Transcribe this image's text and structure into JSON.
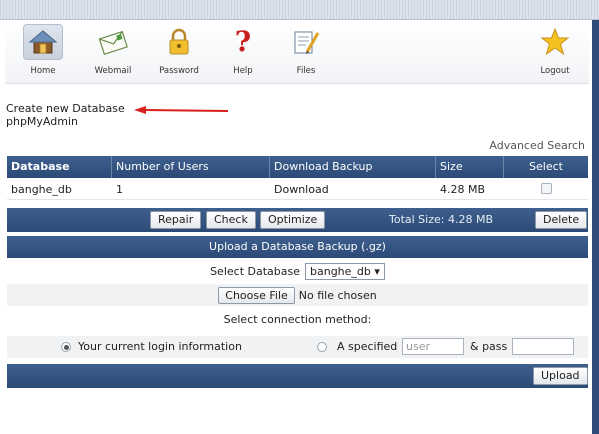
{
  "toolbar": {
    "items": [
      {
        "label": "Home",
        "icon": "home-icon"
      },
      {
        "label": "Webmail",
        "icon": "envelope-icon"
      },
      {
        "label": "Password",
        "icon": "padlock-icon"
      },
      {
        "label": "Help",
        "icon": "question-mark-icon"
      },
      {
        "label": "Files",
        "icon": "files-icon"
      },
      {
        "label": "Logout",
        "icon": "star-icon"
      }
    ]
  },
  "links": {
    "create_db": "Create new Database",
    "phpmyadmin": "phpMyAdmin"
  },
  "advanced_search": "Advanced Search",
  "table": {
    "headers": [
      "Database",
      "Number of Users",
      "Download Backup",
      "Size",
      "Select"
    ],
    "rows": [
      {
        "database": "banghe_db",
        "users": "1",
        "download": "Download",
        "size": "4.28 MB",
        "selected": false
      }
    ]
  },
  "actions": {
    "repair": "Repair",
    "check": "Check",
    "optimize": "Optimize",
    "total": "Total Size: 4.28 MB",
    "delete": "Delete"
  },
  "upload": {
    "header": "Upload a Database Backup (.gz)",
    "select_db_label": "Select Database",
    "select_db_value": "banghe_db",
    "choose_file": "Choose File",
    "no_file": "No file chosen",
    "connection_label": "Select connection method:",
    "current_login": "Your current login information",
    "specified": "A specified",
    "user_placeholder": "user",
    "pass_label": "& pass",
    "upload_button": "Upload"
  },
  "colors": {
    "header_blue": "#2c4a76",
    "arrow_red": "#d9201c"
  }
}
